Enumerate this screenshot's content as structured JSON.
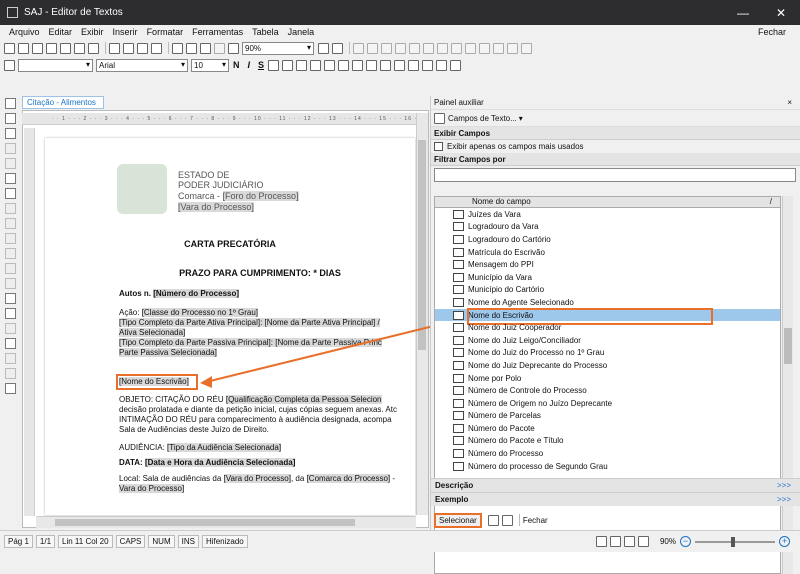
{
  "window": {
    "title": "SAJ - Editor de Textos"
  },
  "menu": [
    "Arquivo",
    "Editar",
    "Exibir",
    "Inserir",
    "Formatar",
    "Ferramentas",
    "Tabela",
    "Janela"
  ],
  "menu_right": "Fechar",
  "toolbar": {
    "zoom": "90%",
    "font": "Arial",
    "font_size": "10",
    "style_bold": "N",
    "style_italic": "I",
    "style_strike": "S"
  },
  "doc_tab": "Citação - Alimentos",
  "document": {
    "header": {
      "line1": "ESTADO DE",
      "line2": "PODER JUDICIÁRIO",
      "line3_prefix": "Comarca -",
      "line3_field": "[Foro do Processo]",
      "line4_field": "[Vara do Processo]"
    },
    "title": "CARTA PRECATÓRIA",
    "subtitle": "PRAZO PARA CUMPRIMENTO: * DIAS",
    "autos_label": "Autos n.",
    "autos_field": "[Número do Processo]",
    "acao_label": "Ação:",
    "acao_field": "[Classe do Processo no 1º Grau]",
    "ativa_line1": "[Tipo Completo da Parte Ativa Principal]: [Nome da Parte Ativa Principal] /",
    "ativa_line2": "Ativa Selecionada]",
    "passiva_line1": "[Tipo Completo da Parte Passiva Principal]: [Nome da Parte Passiva Princ",
    "passiva_line2": "Parte Passiva Selecionada]",
    "escrivao_field": "[Nome do Escrivão]",
    "objeto_line1_prefix": "OBJETO: CITAÇÃO DO RÉU",
    "objeto_line1_field": "[Qualificação Completa da Pessoa Selecion",
    "objeto_line2": "decisão prolatada e diante da petição inicial, cujas cópias seguem anexas. Atc",
    "objeto_line3": "INTIMAÇÃO DO RÉU para comparecimento à audiência designada, acompa",
    "objeto_line4": "Sala de Audiências deste Juízo de Direito.",
    "audiencia_label": "AUDIÊNCIA:",
    "audiencia_field": "[Tipo da Audiência Selecionada]",
    "data_label": "DATA:",
    "data_field": "[Data e Hora da Audiência Selecionada]",
    "local_line1_prefix": "Local: Sala de audiências da",
    "local_line1_field1": "[Vara do Processo]",
    "local_line1_mid": ", da",
    "local_line1_field2": "[Comarca do Processo]",
    "local_line1_suffix": " -",
    "local_line2_field": "Vara do Processo]"
  },
  "panel": {
    "title": "Painel auxiliar",
    "close": "×",
    "tool_label": "Campos de Texto...",
    "section_exibir": "Exibir Campos",
    "checkbox_label": "Exibir apenas os campos mais usados",
    "section_filter": "Filtrar Campos por",
    "column_header": "Nome do campo",
    "sort_indicator": "/",
    "fields": [
      "Juízes da Vara",
      "Logradouro da Vara",
      "Logradouro do Cartório",
      "Matrícula do Escrivão",
      "Mensagem do PPI",
      "Município da Vara",
      "Município do Cartório",
      "Nome do Agente Selecionado",
      "Nome do Escrivão",
      "Nome do Juiz Cooperador",
      "Nome do Juiz Leigo/Conciliador",
      "Nome do Juiz do Processo no 1º Grau",
      "Nome do Juiz Deprecante do Processo",
      "Nome por Polo",
      "Número de Controle do Processo",
      "Número de Origem no Juízo Deprecante",
      "Número de Parcelas",
      "Número do Pacote",
      "Número do Pacote e Título",
      "Número do Processo",
      "Número do processo de Segundo Grau"
    ],
    "selected_field": "Nome do Escrivão",
    "footer_descricao": "Descrição",
    "footer_exemplo": "Exemplo",
    "more": ">>>",
    "btn_select": "Selecionar",
    "btn_close": "Fechar"
  },
  "status": {
    "page": "Pág 1",
    "pages": "1/1",
    "position": "Lin 11 Col 20",
    "caps": "CAPS",
    "num": "NUM",
    "ins": "INS",
    "hyphen": "Hifenizado",
    "zoom": "90%",
    "zoom_minus": "−",
    "zoom_plus": "+"
  },
  "colors": {
    "accent": "#e8702a",
    "selection": "#9ec7ec",
    "link": "#1b73c7"
  }
}
